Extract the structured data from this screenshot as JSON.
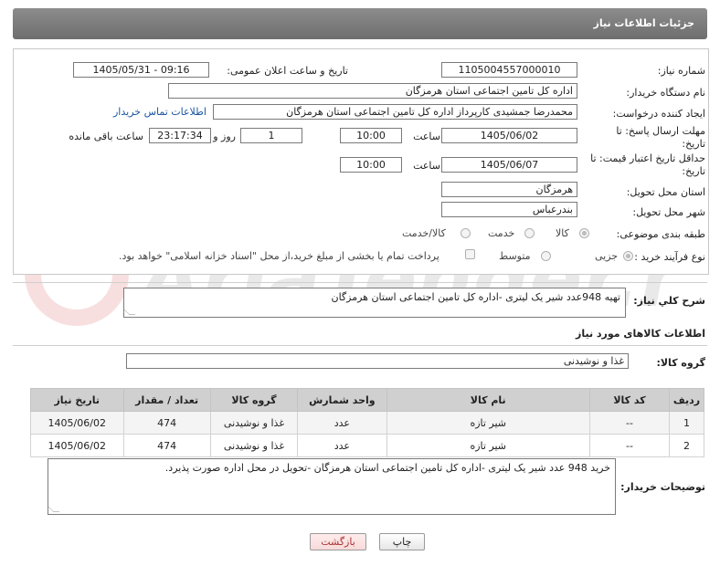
{
  "header": {
    "title": "جزئیات اطلاعات نیاز"
  },
  "form": {
    "need_number_label": "شماره نیاز:",
    "need_number": "1105004557000010",
    "announce_label": "تاریخ و ساعت اعلان عمومی:",
    "announce_value": "1405/05/31 - 09:16",
    "buyer_org_label": "نام دستگاه خریدار:",
    "buyer_org": "اداره کل تامین اجتماعی استان هرمزگان",
    "creator_label": "ایجاد کننده درخواست:",
    "creator": "محمدرضا جمشیدی کارپرداز اداره کل تامین اجتماعی استان هرمزگان",
    "contact_link": "اطلاعات تماس خریدار",
    "deadline_label": "مهلت ارسال پاسخ: تا تاریخ:",
    "deadline_date": "1405/06/02",
    "time_label": "ساعت",
    "deadline_time": "10:00",
    "days": "1",
    "days_label": "روز و",
    "remaining_time": "23:17:34",
    "remaining_label": "ساعت باقی مانده",
    "price_valid_label": "حداقل تاریخ اعتبار قیمت: تا تاریخ:",
    "price_valid_date": "1405/06/07",
    "price_valid_time": "10:00",
    "province_label": "استان محل تحویل:",
    "province": "هرمزگان",
    "city_label": "شهر محل تحویل:",
    "city": "بندرعباس",
    "category_label": "طبقه بندی موضوعی:",
    "category_options": [
      "کالا",
      "خدمت",
      "کالا/خدمت"
    ],
    "process_label": "نوع فرآیند خرید :",
    "process_options": [
      "جزیی",
      "متوسط"
    ],
    "payment_note": "پرداخت تمام یا بخشی از مبلغ خرید،از محل \"اسناد خزانه اسلامی\" خواهد بود."
  },
  "summary": {
    "label": "شرح کلي نياز:",
    "text": "تهیه 948عدد شیر یک لیتری -اداره کل تامین اجتماعی استان هرمزگان"
  },
  "goods": {
    "section_title": "اطلاعات کالاهای مورد نیاز",
    "group_label": "گروه کالا:",
    "group_value": "غذا و نوشیدنی",
    "columns": [
      "ردیف",
      "کد کالا",
      "نام کالا",
      "واحد شمارش",
      "گروه کالا",
      "تعداد / مقدار",
      "تاریخ نیاز"
    ],
    "rows": [
      [
        "1",
        "--",
        "شیر تازه",
        "عدد",
        "غذا و نوشیدنی",
        "474",
        "1405/06/02"
      ],
      [
        "2",
        "--",
        "شیر تازه",
        "عدد",
        "غذا و نوشیدنی",
        "474",
        "1405/06/02"
      ]
    ]
  },
  "buyer_notes": {
    "label": "توضیحات خریدار:",
    "text": "خرید 948 عدد شیر یک لیتری -اداره کل تامین اجتماعی استان هرمزگان -تحویل در محل اداره صورت پذیرد."
  },
  "buttons": {
    "print": "چاپ",
    "back": "بازگشت"
  },
  "watermark": {
    "text": "AriaTender.net"
  }
}
